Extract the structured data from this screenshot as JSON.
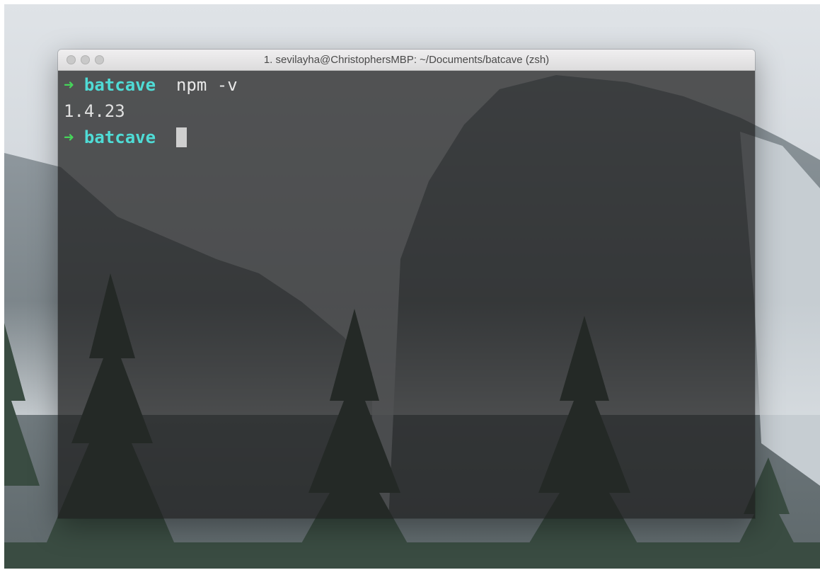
{
  "window": {
    "title": "1. sevilayha@ChristophersMBP: ~/Documents/batcave (zsh)",
    "traffic_lights": [
      "close",
      "minimize",
      "zoom"
    ]
  },
  "terminal": {
    "prompt_symbol": "➜",
    "lines": [
      {
        "type": "prompt",
        "directory": "batcave",
        "command": "npm -v"
      },
      {
        "type": "output",
        "text": "1.4.23"
      },
      {
        "type": "prompt",
        "directory": "batcave",
        "command": ""
      }
    ]
  },
  "colors": {
    "prompt_arrow": "#46d45a",
    "directory": "#4fdcd6",
    "text": "#e4e4e4",
    "cursor": "#cfcfcf"
  },
  "icons": {
    "prompt_arrow": "right-arrow-icon",
    "close": "close-icon",
    "minimize": "minimize-icon",
    "zoom": "zoom-icon"
  }
}
